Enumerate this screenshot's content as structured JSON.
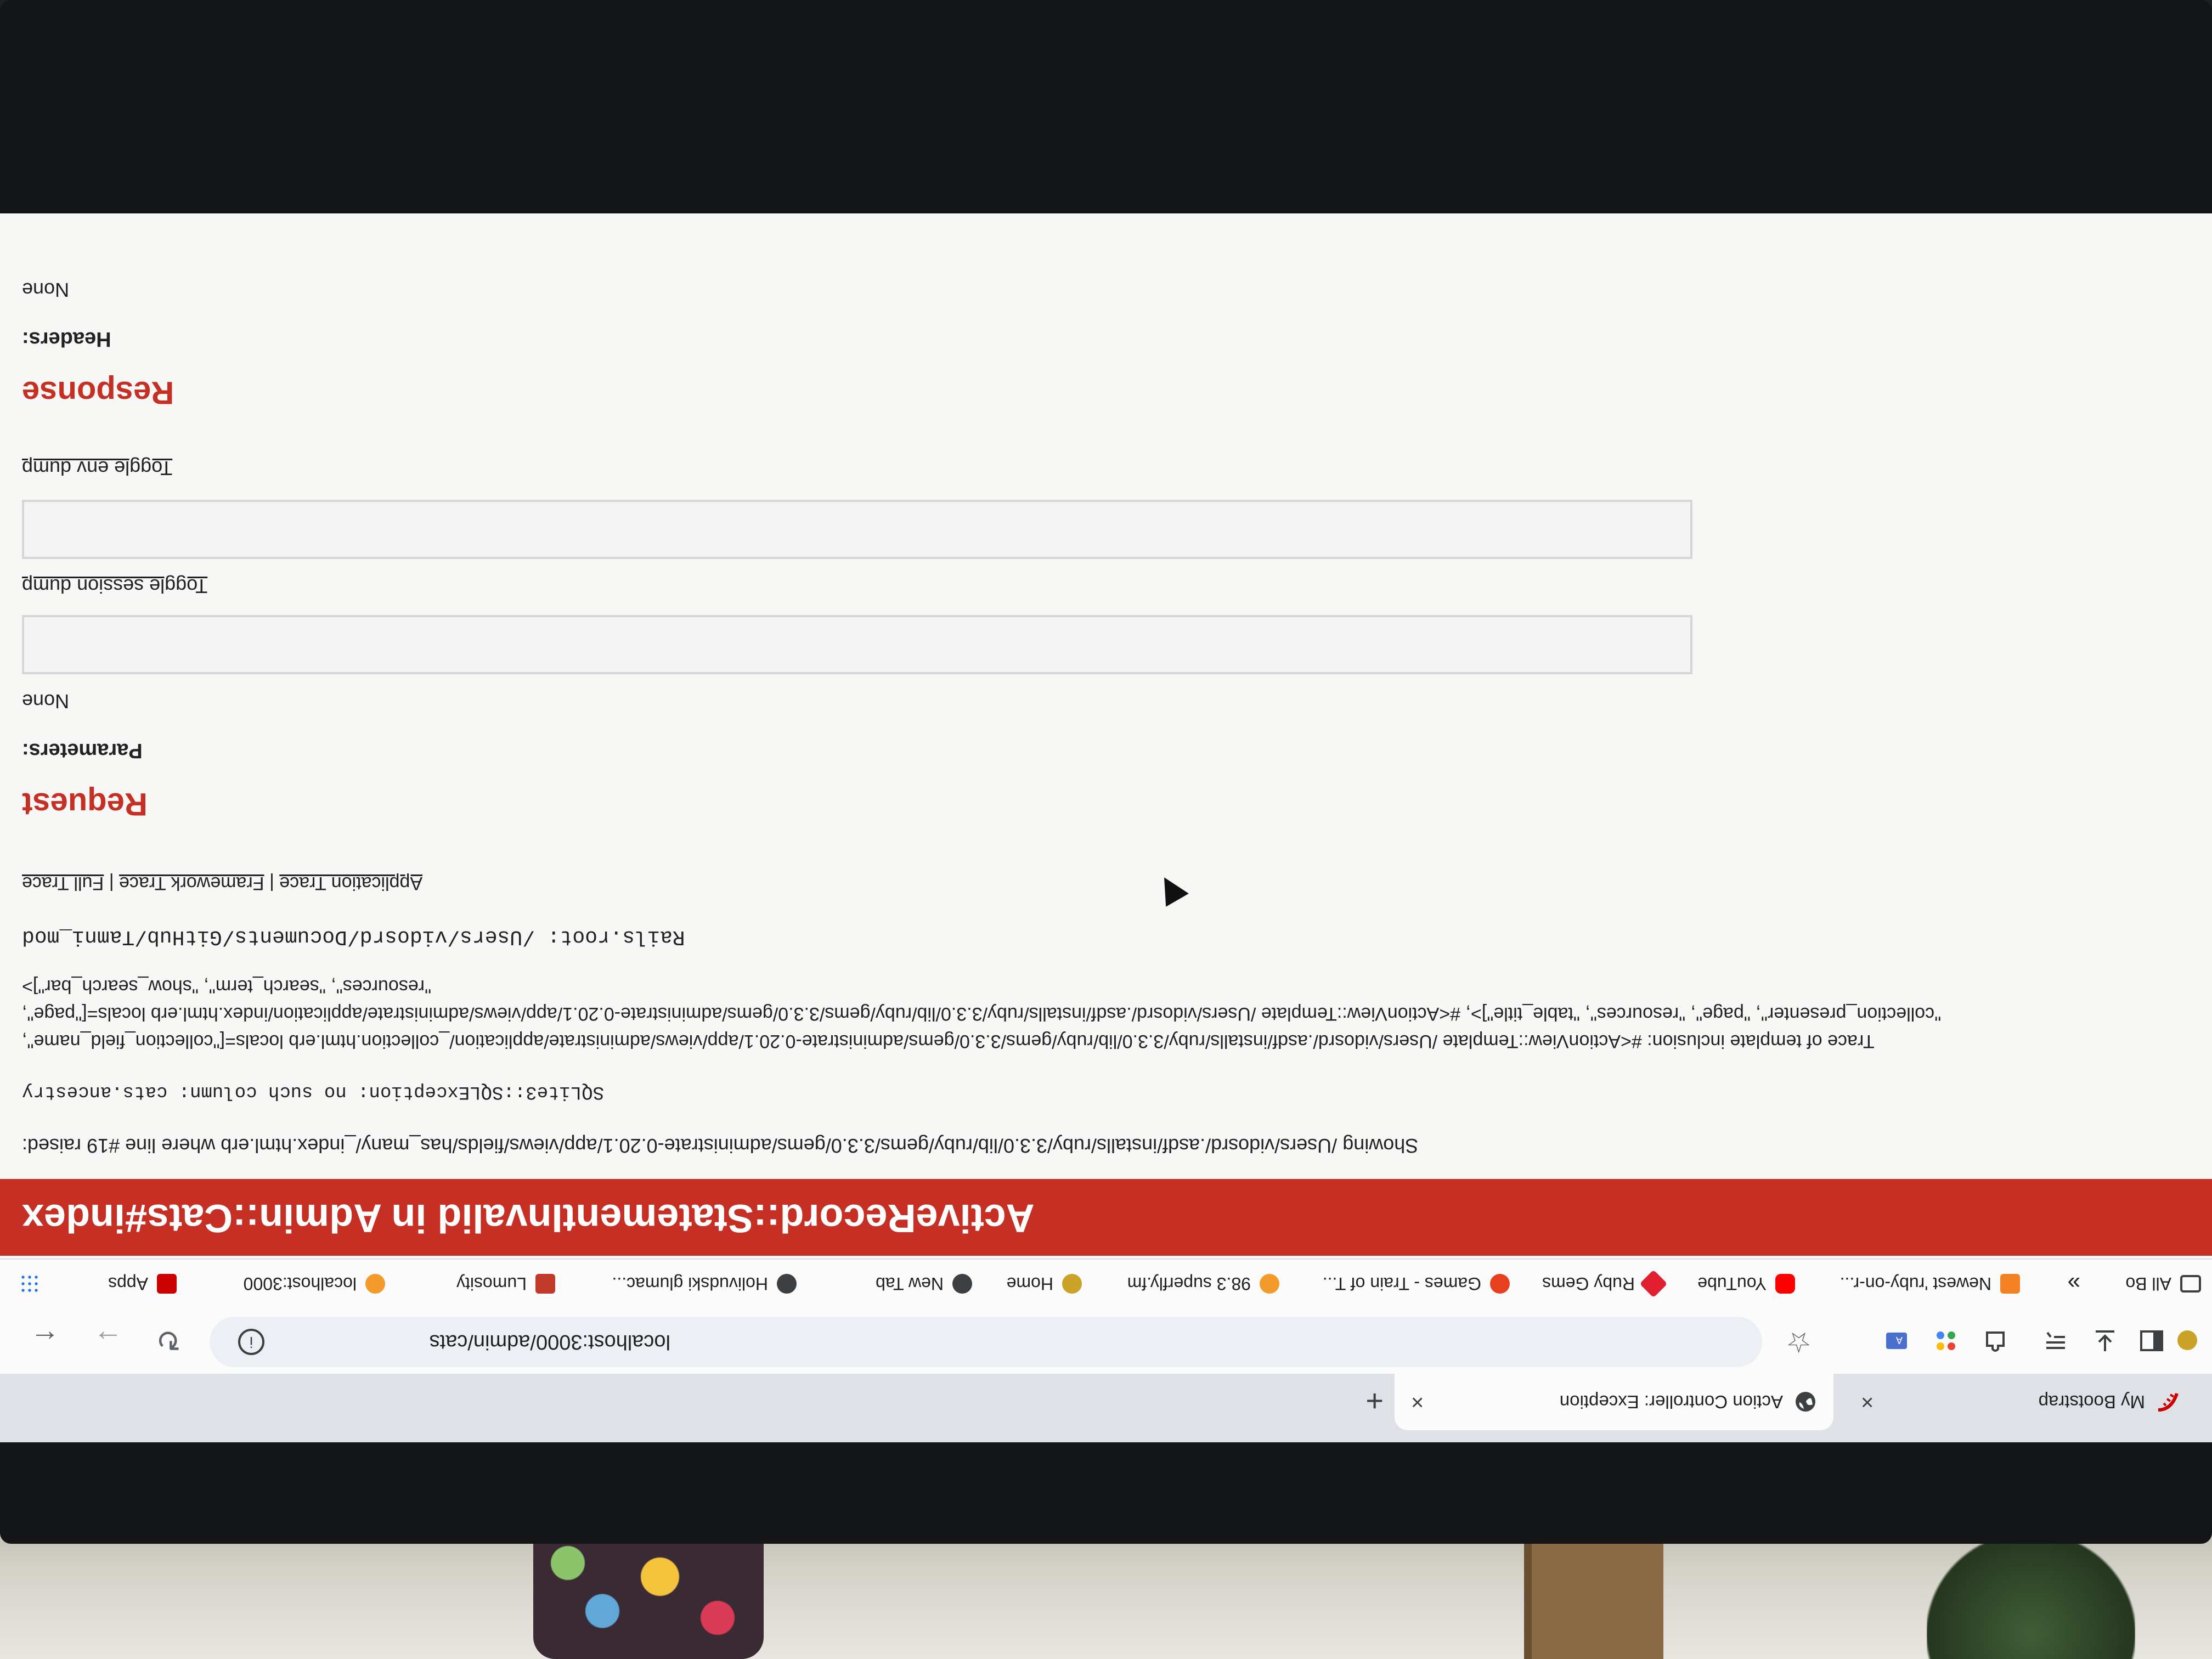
{
  "browser": {
    "tabs": [
      {
        "title": "My Bootstrap",
        "icon": "rails-icon",
        "active": false
      },
      {
        "title": "Action Controller: Exception",
        "icon": "globe-icon",
        "active": true
      }
    ],
    "close_glyph": "×",
    "new_tab_glyph": "+",
    "url": "localhost:3000/admin/cats",
    "info_glyph": "i"
  },
  "bookmarks": [
    {
      "label": "Apps",
      "icon": "apps-grid-icon",
      "color": "#1a73e8"
    },
    {
      "label": "localhost:3000",
      "icon": "rails-icon",
      "color": "#cc0000"
    },
    {
      "label": "Lumosity",
      "icon": "lumosity-icon",
      "color": "#f29b2a"
    },
    {
      "label": "Holivudski glumac...",
      "icon": "imdb-icon",
      "color": "#c0392b"
    },
    {
      "label": "New Tab",
      "icon": "globe-icon",
      "color": "#3c4043"
    },
    {
      "label": "Home",
      "icon": "home-icon",
      "color": "#c9a227"
    },
    {
      "label": "98.3 superfly.fm",
      "icon": "globe-icon",
      "color": "#3c4043"
    },
    {
      "label": "Games - Train of T...",
      "icon": "games-icon",
      "color": "#f29b2a"
    },
    {
      "label": "Ruby Gems",
      "icon": "rubygems-icon",
      "color": "#e0202f"
    },
    {
      "label": "YouTube",
      "icon": "youtube-icon",
      "color": "#ff0000"
    },
    {
      "label": "Newest 'ruby-on-r...",
      "icon": "stackoverflow-icon",
      "color": "#f48024"
    },
    {
      "label": "»",
      "icon": "more-icon",
      "color": "#3c4043"
    },
    {
      "label": "All Bo",
      "icon": "folder-icon",
      "color": "#3c4043"
    }
  ],
  "page": {
    "title": "ActiveRecord::StatementInvalid in Admin::Cats#index",
    "showing_line": "Showing /Users/vidosrd/.asdf/installs/ruby/3.3.0/lib/ruby/gems/3.3.0/gems/administrate-0.20.1/app/views/fields/has_many/_index.html.erb where line #19 raised:",
    "exception": "SQLite3::SQLException: no such column: cats.ancestry",
    "trace_line_1": "Trace of template inclusion: #<ActionView::Template /Users/vidosrd/.asdf/installs/ruby/3.3.0/lib/ruby/gems/3.3.0/gems/administrate-0.20.1/app/views/administrate/application/_collection.html.erb locals=[\"collection_field_name\",",
    "trace_line_2": "\"collection_presenter\", \"page\", \"resources\", \"table_title\"]>, #<ActionView::Template /Users/vidosrd/.asdf/installs/ruby/3.3.0/lib/ruby/gems/3.3.0/gems/administrate-0.20.1/app/views/administrate/application/index.html.erb locals=[\"page\",",
    "trace_line_3": "\"resources\", \"search_term\", \"show_search_bar\"]>",
    "rails_root": "Rails.root: /Users/vidosrd/Documents/GitHub/Tamni_mod",
    "trace_links": {
      "application": "Application Trace",
      "framework": "Framework Trace",
      "full": "Full Trace",
      "separator": "|"
    },
    "request_heading": "Request",
    "parameters_label": "Parameters:",
    "parameters_value": "None",
    "toggle_session": "Toggle session dump",
    "toggle_env": "Toggle env dump",
    "response_heading": "Response",
    "headers_label": "Headers:",
    "headers_value": "None"
  }
}
